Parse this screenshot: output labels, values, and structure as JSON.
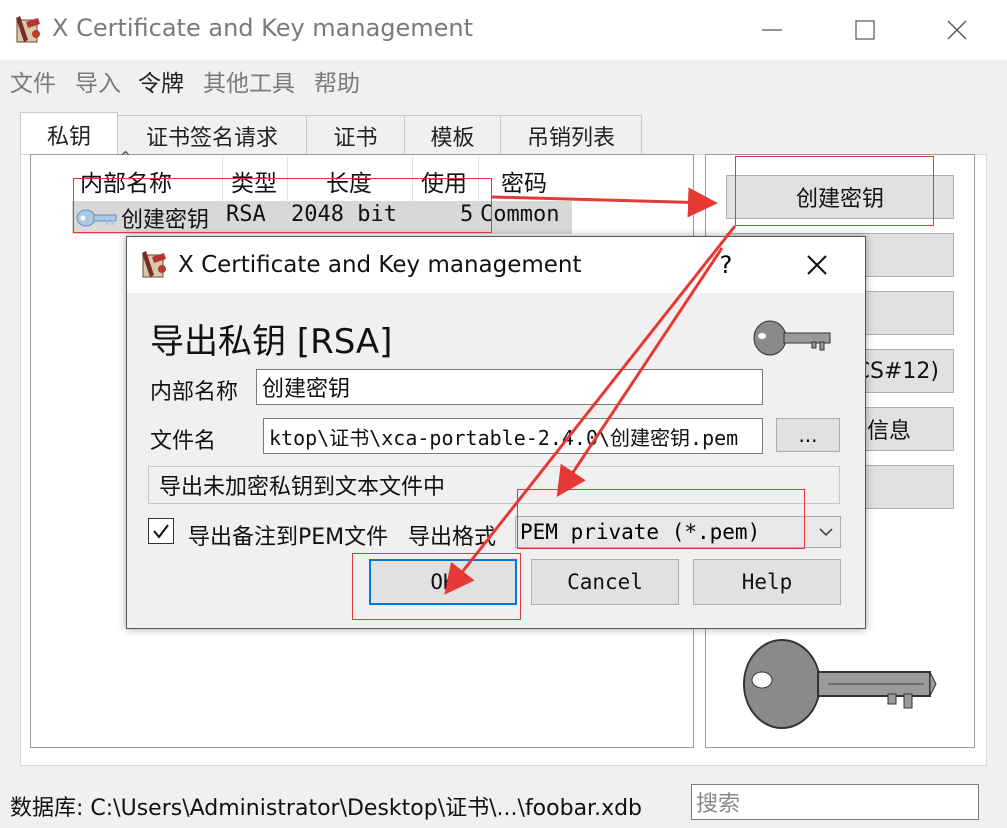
{
  "window": {
    "title": "X Certificate and Key management"
  },
  "menu": [
    "文件",
    "导入",
    "令牌",
    "其他工具",
    "帮助"
  ],
  "tabs": [
    "私钥",
    "证书签名请求",
    "证书",
    "模板",
    "吊销列表"
  ],
  "key_table": {
    "columns": [
      "内部名称",
      "类型",
      "长度",
      "使用",
      "密码"
    ],
    "rows": [
      {
        "name": "创建密钥",
        "type": "RSA",
        "size": "2048 bit",
        "use": "5",
        "password": "Common"
      }
    ]
  },
  "side_buttons": [
    "创建密钥",
    "",
    "",
    "CS#12)",
    "信息",
    ""
  ],
  "status": {
    "database": "数据库: C:\\Users\\Administrator\\Desktop\\证书\\...\\foobar.xdb"
  },
  "search": {
    "placeholder": "搜索"
  },
  "dialog": {
    "title": "X Certificate and Key management",
    "help": "?",
    "heading": "导出私钥 [RSA]",
    "internal_name_label": "内部名称",
    "internal_name_value": "创建密钥",
    "filename_label": "文件名",
    "filename_value": "ktop\\证书\\xca-portable-2.4.0\\创建密钥.pem",
    "browse": "...",
    "description": "导出未加密私钥到文本文件中",
    "pem_comment_label": "导出备注到PEM文件",
    "pem_comment_checked": true,
    "format_label": "导出格式",
    "format_value": "PEM private (*.pem)",
    "ok": "OK",
    "cancel": "Cancel",
    "help_button": "Help"
  },
  "colors": {
    "annotation_red": "#e53935",
    "focus_blue": "#0078d7"
  },
  "icons": [
    "app-icon",
    "minimize-icon",
    "maximize-icon",
    "close-icon",
    "key-icon",
    "checkbox-check-icon",
    "chevron-down-icon"
  ]
}
